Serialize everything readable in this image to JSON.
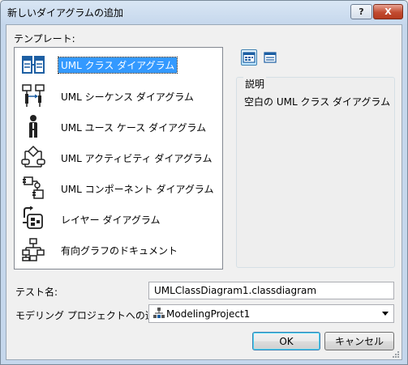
{
  "window": {
    "title": "新しいダイアグラムの追加",
    "help_label": "?",
    "close_label": "X"
  },
  "templates": {
    "label": "テンプレート:",
    "items": [
      {
        "label": "UML クラス ダイアグラム",
        "icon": "class-diagram-icon",
        "selected": true
      },
      {
        "label": "UML シーケンス ダイアグラム",
        "icon": "sequence-diagram-icon",
        "selected": false
      },
      {
        "label": "UML ユース ケース ダイアグラム",
        "icon": "use-case-diagram-icon",
        "selected": false
      },
      {
        "label": "UML アクティビティ ダイアグラム",
        "icon": "activity-diagram-icon",
        "selected": false
      },
      {
        "label": "UML コンポーネント ダイアグラム",
        "icon": "component-diagram-icon",
        "selected": false
      },
      {
        "label": "レイヤー ダイアグラム",
        "icon": "layer-diagram-icon",
        "selected": false
      },
      {
        "label": "有向グラフのドキュメント",
        "icon": "directed-graph-icon",
        "selected": false
      }
    ]
  },
  "view_buttons": {
    "large_icons": "large-icons-view-icon",
    "small_icons": "small-icons-view-icon"
  },
  "description": {
    "legend": "説明",
    "text": "空白の UML クラス ダイアグラム"
  },
  "form": {
    "name_label": "テスト名:",
    "name_value": "UMLClassDiagram1.classdiagram",
    "project_label": "モデリング プロジェクトへの追加:",
    "project_value": "ModelingProject1",
    "project_icon": "modeling-project-icon"
  },
  "buttons": {
    "ok": "OK",
    "cancel": "キャンセル"
  },
  "colors": {
    "selection": "#3399ff",
    "icon_blue": "#1d5fa3",
    "titlebar": "#c5d7ec",
    "close_red": "#c24b30"
  }
}
